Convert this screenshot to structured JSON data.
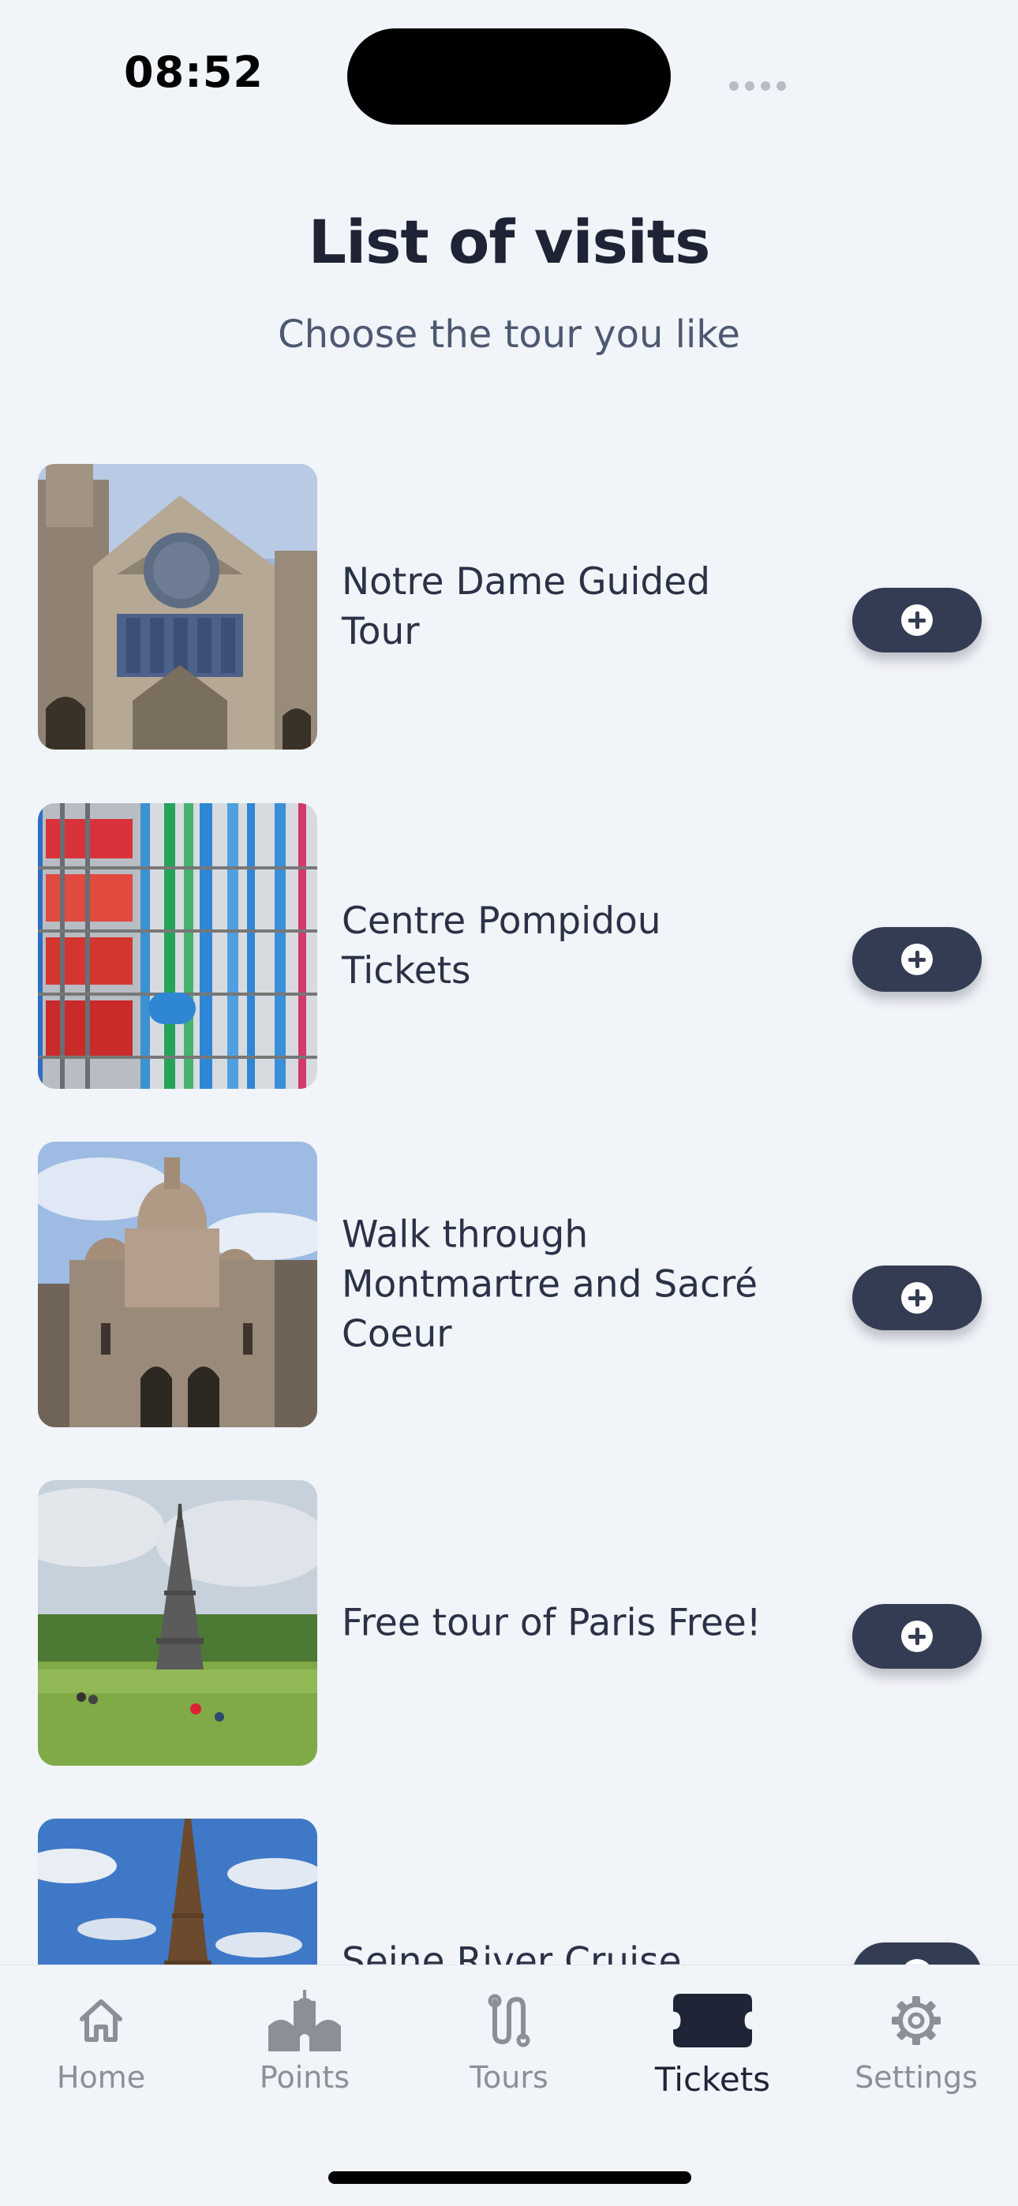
{
  "status_bar": {
    "time": "08:52"
  },
  "header": {
    "title": "List of visits",
    "subtitle": "Choose the tour you like"
  },
  "tours": [
    {
      "name": "Notre Dame Guided Tour",
      "image": "notre-dame-photo"
    },
    {
      "name": "Centre Pompidou Tickets",
      "image": "centre-pompidou-photo"
    },
    {
      "name": "Walk through Montmartre and Sacré Coeur",
      "image": "sacre-coeur-photo"
    },
    {
      "name": "Free tour of Paris Free!",
      "image": "eiffel-tower-park-photo"
    },
    {
      "name": "Seine River Cruise",
      "image": "eiffel-tower-sky-photo"
    }
  ],
  "add_button_icon": "plus-circle-icon",
  "tab_bar": {
    "tabs": [
      {
        "label": "Home",
        "icon": "house-icon",
        "active": false
      },
      {
        "label": "Points",
        "icon": "building-icon",
        "active": false
      },
      {
        "label": "Tours",
        "icon": "route-icon",
        "active": false
      },
      {
        "label": "Tickets",
        "icon": "ticket-icon",
        "active": true
      },
      {
        "label": "Settings",
        "icon": "gear-icon",
        "active": false
      }
    ]
  },
  "colors": {
    "background": "#f1f4f9",
    "button": "#333c52",
    "title": "#1e2435",
    "subtitle": "#4e5870",
    "tab_inactive": "#8c8f96",
    "tab_active": "#1f2436"
  }
}
